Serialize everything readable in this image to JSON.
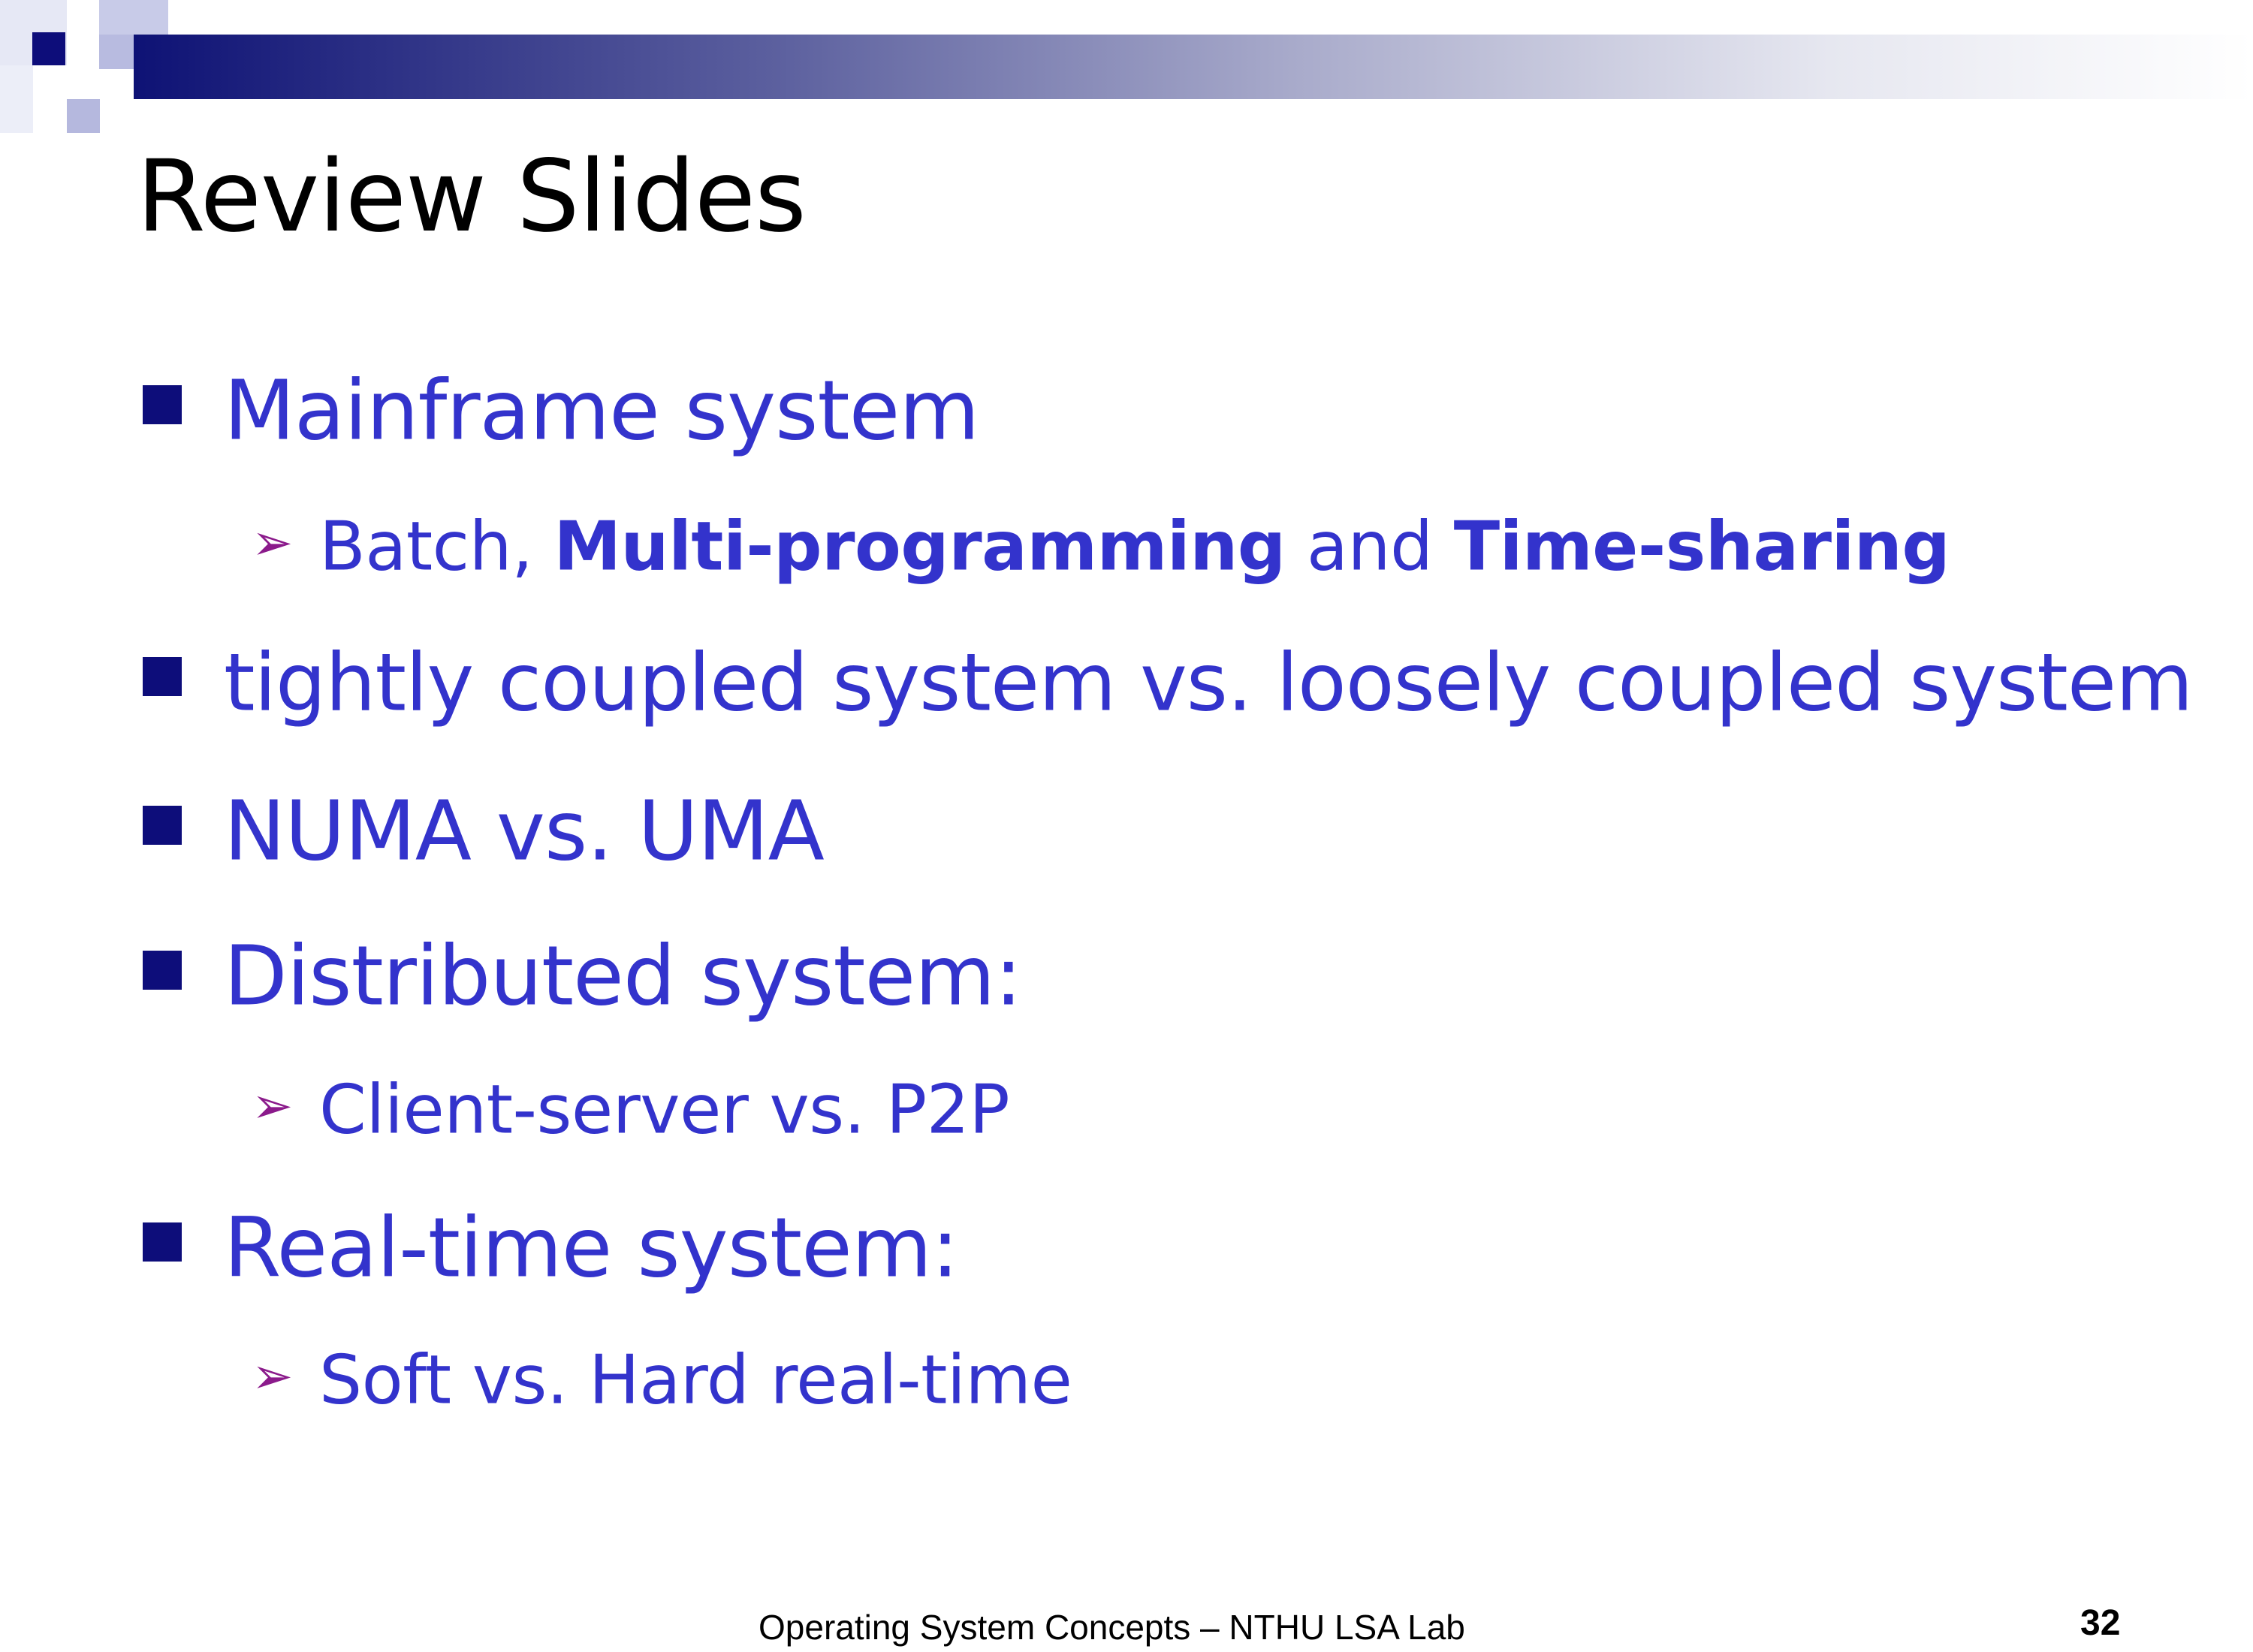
{
  "slide": {
    "title": "Review Slides",
    "items": [
      {
        "level": 1,
        "text": "Mainframe system"
      },
      {
        "level": 2,
        "parts": [
          "Batch, ",
          "Multi-programming",
          " and ",
          "Time-sharing"
        ]
      },
      {
        "level": 1,
        "text": "tightly coupled system vs. loosely coupled system"
      },
      {
        "level": 1,
        "text": "NUMA vs. UMA"
      },
      {
        "level": 1,
        "text": "Distributed system:"
      },
      {
        "level": 2,
        "text": "Client-server vs. P2P"
      },
      {
        "level": 1,
        "text": "Real-time system:"
      },
      {
        "level": 2,
        "text": "Soft vs. Hard real-time"
      }
    ],
    "footer": "Operating System Concepts – NTHU LSA Lab",
    "page_number": "32"
  },
  "colors": {
    "body_text": "#3333cc",
    "title_text": "#000000",
    "square_bullet": "#0d0d7a",
    "arrow_bullet": "#8b1a8b",
    "header_gradient_start": "#0e1275",
    "header_gradient_end": "#ffffff"
  },
  "icons": {
    "level1_bullet": "square-bullet-icon",
    "level2_bullet": "arrow-bullet-icon"
  }
}
